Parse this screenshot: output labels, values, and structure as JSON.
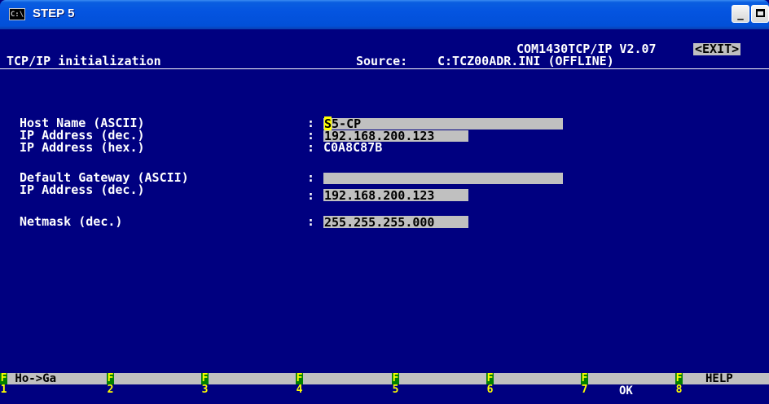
{
  "window": {
    "icon_text": "C:\\",
    "title": "STEP 5",
    "minimize_glyph": "_",
    "close_glyph": "X"
  },
  "header": {
    "product": "COM1430TCP/IP V2.07",
    "exit_label": "<EXIT>",
    "screen_title": "TCP/IP initialization",
    "source_label": "Source:",
    "source_value": "C:TCZ00ADR.INI (OFFLINE)"
  },
  "fields": {
    "host_name": {
      "label": "Host Name (ASCII)",
      "colon": ":",
      "cursor_char": "S",
      "value_rest": "5-CP"
    },
    "ip_dec": {
      "label": "IP Address (dec.)",
      "colon": ":",
      "value": "192.168.200.123"
    },
    "ip_hex": {
      "label": "IP Address (hex.)",
      "colon": ":",
      "value": "C0A8C87B"
    },
    "gateway_name": {
      "label": "Default Gateway (ASCII)",
      "colon": ":",
      "value": ""
    },
    "gateway_ip": {
      "label": "IP Address (dec.)",
      "colon": ":",
      "value": "192.168.200.123"
    },
    "netmask": {
      "label": "Netmask (dec.)",
      "colon": ":",
      "value": "255.255.255.000"
    }
  },
  "function_keys": [
    {
      "letter": "F",
      "number": "1",
      "top_label": " Ho->Ga",
      "bottom_label": ""
    },
    {
      "letter": "F",
      "number": "2",
      "top_label": "",
      "bottom_label": ""
    },
    {
      "letter": "F",
      "number": "3",
      "top_label": "",
      "bottom_label": ""
    },
    {
      "letter": "F",
      "number": "4",
      "top_label": "",
      "bottom_label": ""
    },
    {
      "letter": "F",
      "number": "5",
      "top_label": "",
      "bottom_label": ""
    },
    {
      "letter": "F",
      "number": "6",
      "top_label": "",
      "bottom_label": ""
    },
    {
      "letter": "F",
      "number": "7",
      "top_label": "",
      "bottom_label": "OK"
    },
    {
      "letter": "F",
      "number": "8",
      "top_label": "HELP",
      "bottom_label": ""
    }
  ],
  "colors": {
    "console_bg": "#000080",
    "text": "#ffffff",
    "field_bg": "#c0c0c0",
    "cursor": "#ffff00",
    "fkey_letter": "#ffff00",
    "fkey_letter_bg": "#008000",
    "titlebar": "#0454e0"
  }
}
